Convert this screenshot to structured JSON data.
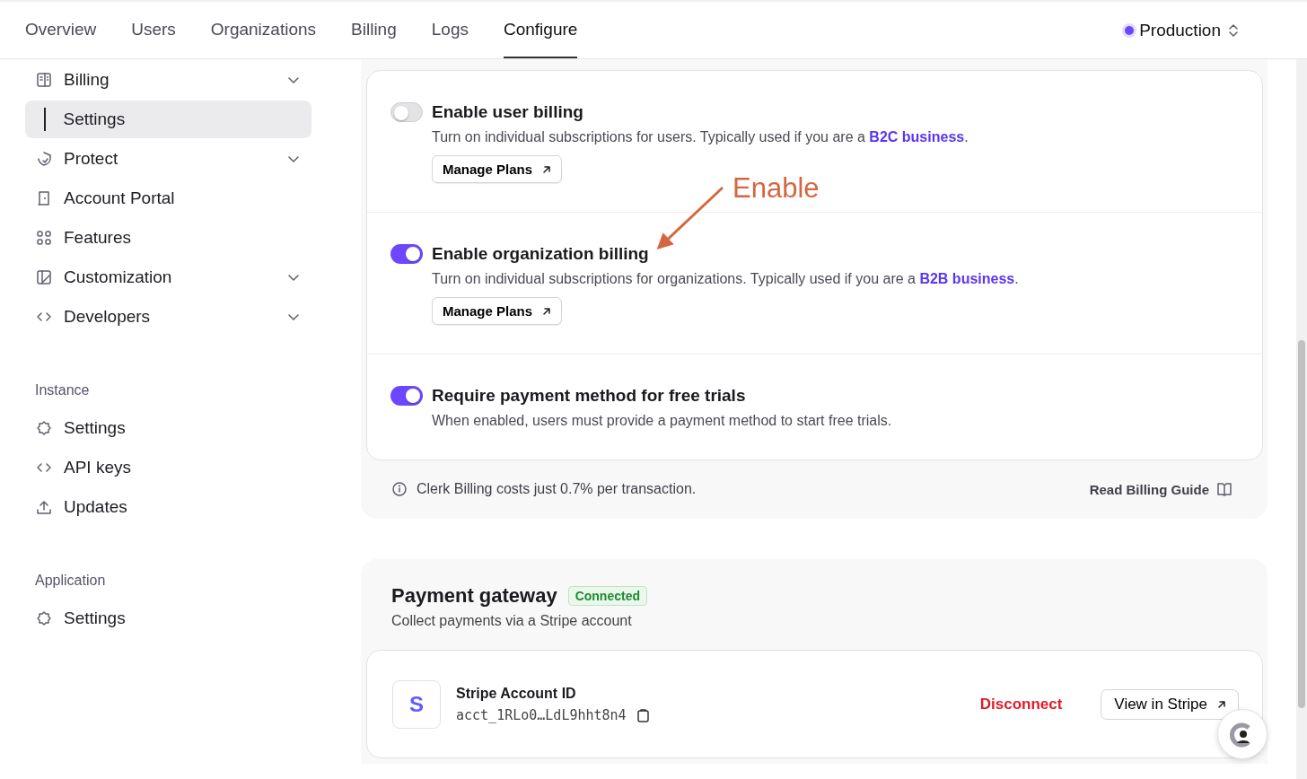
{
  "nav": {
    "tabs": [
      {
        "label": "Overview",
        "selected": false
      },
      {
        "label": "Users",
        "selected": false
      },
      {
        "label": "Organizations",
        "selected": false
      },
      {
        "label": "Billing",
        "selected": false
      },
      {
        "label": "Logs",
        "selected": false
      },
      {
        "label": "Configure",
        "selected": true
      }
    ],
    "environment": {
      "label": "Production"
    }
  },
  "sidebar": {
    "sections": [
      {
        "items": [
          {
            "label": "Billing",
            "kind": "group",
            "selected": false
          },
          {
            "label": "Settings",
            "kind": "sub",
            "selected": true
          },
          {
            "label": "Protect",
            "kind": "group",
            "selected": false
          },
          {
            "label": "Account Portal",
            "kind": "link",
            "selected": false
          },
          {
            "label": "Features",
            "kind": "link",
            "selected": false
          },
          {
            "label": "Customization",
            "kind": "group",
            "selected": false
          },
          {
            "label": "Developers",
            "kind": "group",
            "selected": false
          }
        ]
      },
      {
        "heading": "Instance",
        "items": [
          {
            "label": "Settings",
            "kind": "link",
            "selected": false
          },
          {
            "label": "API keys",
            "kind": "link",
            "selected": false
          },
          {
            "label": "Updates",
            "kind": "link",
            "selected": false
          }
        ]
      },
      {
        "heading": "Application",
        "items": [
          {
            "label": "Settings",
            "kind": "link",
            "selected": false
          }
        ]
      }
    ]
  },
  "billing": {
    "options": [
      {
        "title": "Enable user billing",
        "on": false,
        "description": "Turn on individual subscriptions for users. Typically used if you are a ",
        "link": "B2C business",
        "description_end": ".",
        "button": "Manage Plans"
      },
      {
        "title": "Enable organization billing",
        "on": true,
        "description": "Turn on individual subscriptions for organizations. Typically used if you are a ",
        "link": "B2B business",
        "description_end": ".",
        "button": "Manage Plans"
      },
      {
        "title": "Require payment method for free trials",
        "on": true,
        "description": "When enabled, users must provide a payment method to start free trials."
      }
    ],
    "note": "Clerk Billing costs just 0.7% per transaction.",
    "guide_link": "Read Billing Guide"
  },
  "annotation": {
    "text": "Enable"
  },
  "gateway": {
    "title": "Payment gateway",
    "badge": "Connected",
    "subtitle": "Collect payments via a Stripe account",
    "account": {
      "logo": "S",
      "label": "Stripe Account ID",
      "id": "acct_1RLo0…LdL9hht8n4",
      "disconnect": "Disconnect",
      "view": "View in Stripe"
    }
  }
}
